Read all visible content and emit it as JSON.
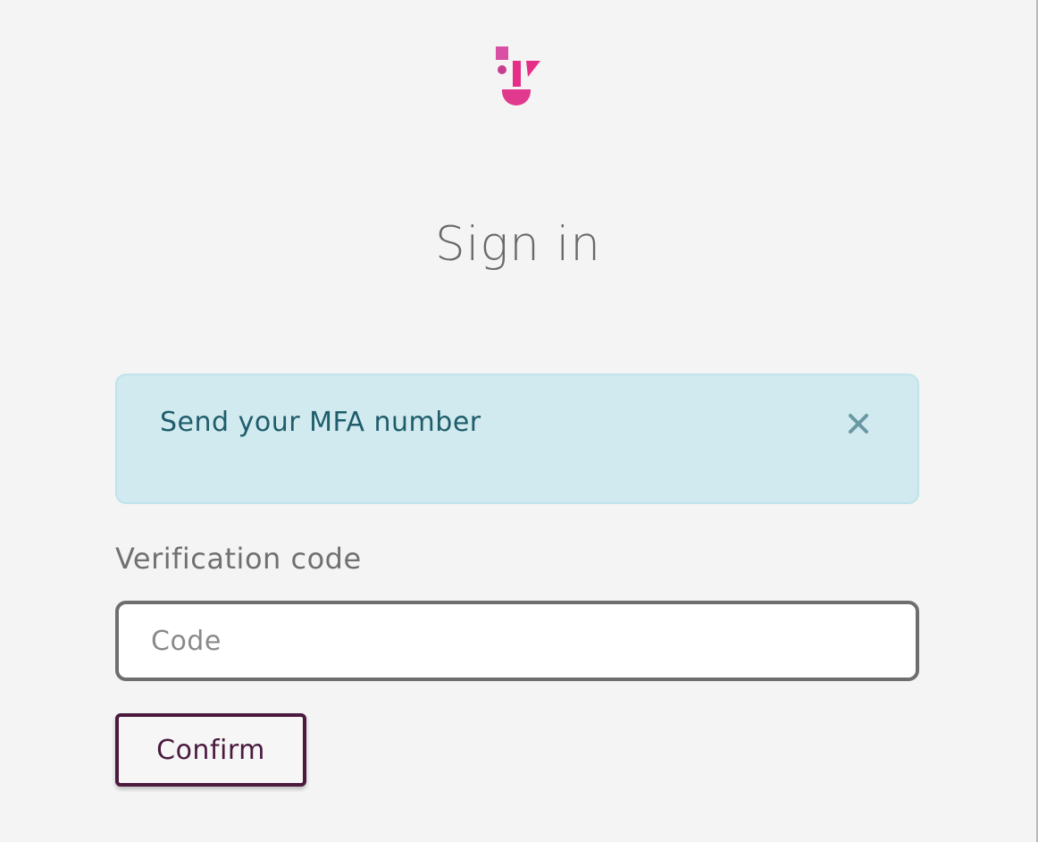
{
  "page": {
    "title": "Sign in"
  },
  "brand": {
    "logo_icon": "brand-logo-icon",
    "colors": {
      "pink": "#e62e86",
      "pink_light": "#d94fa4",
      "magenta": "#c83d8f"
    }
  },
  "alert": {
    "message": "Send your MFA number",
    "close_icon": "close-icon",
    "background": "#d0eaef",
    "text_color": "#1f5d6b"
  },
  "form": {
    "label": "Verification code",
    "input_placeholder": "Code",
    "input_value": "",
    "submit_label": "Confirm",
    "submit_color": "#4a1a3e"
  }
}
